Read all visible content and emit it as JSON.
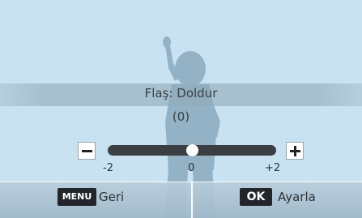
{
  "popup": {
    "title": "Flaş: Doldur",
    "value": "(0)"
  },
  "slider": {
    "current_value": 0,
    "min": -2,
    "max": 2,
    "ticks": [
      "-2",
      "0",
      "+2"
    ],
    "minus_icon": "minus-icon",
    "plus_icon": "plus-icon"
  },
  "bottom_bar": {
    "menu_key": "MENU",
    "back_label": "Geri",
    "ok_key": "OK",
    "set_label": "Ayarla"
  },
  "colors": {
    "background": "#c8e2f2",
    "silhouette": "#94b2c6",
    "track": "#3b3f44",
    "key": "#22262a"
  }
}
